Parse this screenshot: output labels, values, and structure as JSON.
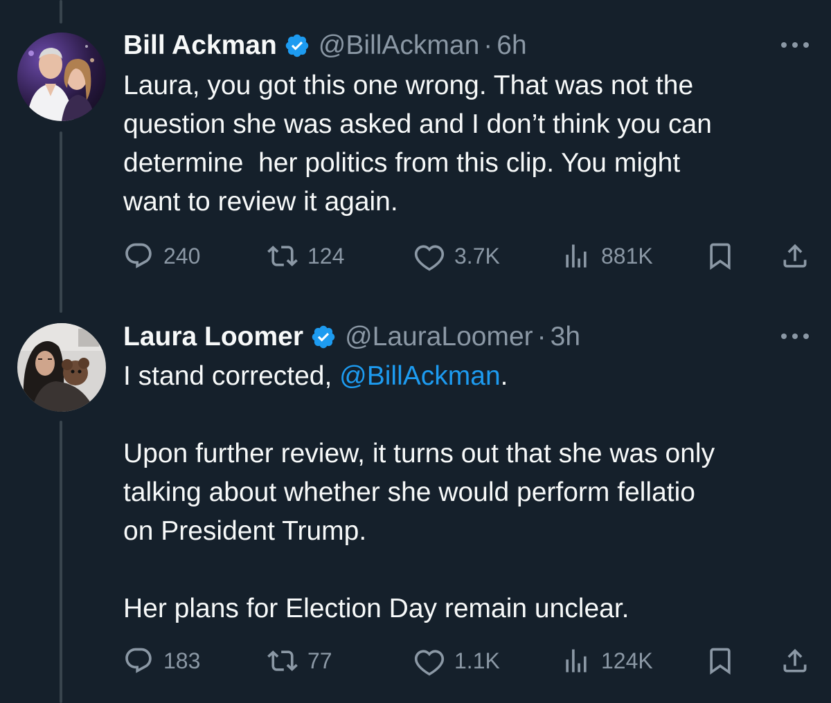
{
  "colors": {
    "background": "#15202b",
    "text": "#f7f9f9",
    "muted": "#8b98a5",
    "accent": "#1d9bf0",
    "thread_line": "#38444d"
  },
  "tweets": [
    {
      "name": "Bill Ackman",
      "handle": "@BillAckman",
      "separator": "·",
      "time": "6h",
      "verified": true,
      "text": "Laura, you got this one wrong. That was not the\nquestion she was asked and I don’t think you can\ndetermine  her politics from this clip. You might\nwant to review it again.",
      "replies": "240",
      "retweets": "124",
      "likes": "3.7K",
      "views": "881K"
    },
    {
      "name": "Laura Loomer",
      "handle": "@LauraLoomer",
      "separator": "·",
      "time": "3h",
      "verified": true,
      "text_before_mention": "I stand corrected, ",
      "mention": "@BillAckman",
      "text_after_mention": ".\n\nUpon further review, it turns out that she was only\ntalking about whether she would perform fellatio\non President Trump.\n\nHer plans for Election Day remain unclear.",
      "replies": "183",
      "retweets": "77",
      "likes": "1.1K",
      "views": "124K"
    }
  ],
  "icons": {
    "reply": "speech-bubble-icon",
    "retweet": "retweet-arrows-icon",
    "like": "heart-icon",
    "views": "bar-chart-icon",
    "bookmark": "bookmark-icon",
    "share": "share-upload-icon",
    "more": "three-dots-icon",
    "verified": "verified-badge-icon"
  }
}
